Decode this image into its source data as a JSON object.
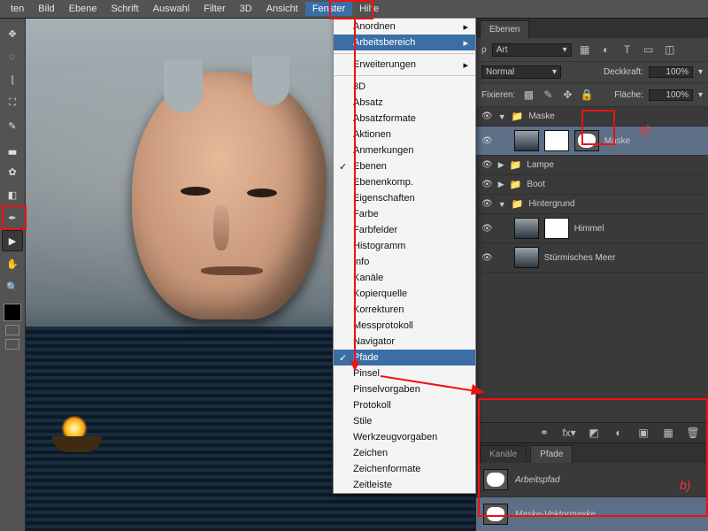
{
  "menubar": [
    "ten",
    "Bild",
    "Ebene",
    "Schrift",
    "Auswahl",
    "Filter",
    "3D",
    "Ansicht",
    "Fenster",
    "Hilfe"
  ],
  "menubar_open": 8,
  "dropdown": {
    "sections": [
      [
        {
          "label": "Anordnen",
          "sub": true
        },
        {
          "label": "Arbeitsbereich",
          "sub": true,
          "hl": true
        }
      ],
      [
        {
          "label": "Erweiterungen",
          "sub": true
        }
      ],
      [
        {
          "label": "3D"
        },
        {
          "label": "Absatz"
        },
        {
          "label": "Absatzformate"
        },
        {
          "label": "Aktionen"
        },
        {
          "label": "Anmerkungen"
        },
        {
          "label": "Ebenen",
          "chk": true
        },
        {
          "label": "Ebenenkomp."
        },
        {
          "label": "Eigenschaften"
        },
        {
          "label": "Farbe"
        },
        {
          "label": "Farbfelder"
        },
        {
          "label": "Histogramm"
        },
        {
          "label": "Info"
        },
        {
          "label": "Kanäle"
        },
        {
          "label": "Kopierquelle"
        },
        {
          "label": "Korrekturen"
        },
        {
          "label": "Messprotokoll"
        },
        {
          "label": "Navigator"
        },
        {
          "label": "Pfade",
          "chk": true,
          "hl": true
        },
        {
          "label": "Pinsel"
        },
        {
          "label": "Pinselvorgaben"
        },
        {
          "label": "Protokoll"
        },
        {
          "label": "Stile"
        },
        {
          "label": "Werkzeugvorgaben"
        },
        {
          "label": "Zeichen"
        },
        {
          "label": "Zeichenformate"
        },
        {
          "label": "Zeitleiste"
        }
      ]
    ]
  },
  "right": {
    "panel_tab": "Ebenen",
    "filter_label": "Art",
    "blend": "Normal",
    "opacity_label": "Deckkraft:",
    "opacity": "100%",
    "lock_label": "Fixieren:",
    "fill_label": "Fläche:",
    "fill": "100%",
    "layers": [
      {
        "type": "group",
        "name": "Maske",
        "open": true
      },
      {
        "type": "layer",
        "name": "Maske",
        "sel": true,
        "indent": 1,
        "thumbs": [
          "img",
          "white",
          "vpath"
        ]
      },
      {
        "type": "group",
        "name": "Lampe",
        "indent": 0
      },
      {
        "type": "group",
        "name": "Boot",
        "indent": 0
      },
      {
        "type": "group",
        "name": "Hintergrund",
        "open": true,
        "indent": 0
      },
      {
        "type": "layer",
        "name": "Himmel",
        "indent": 1,
        "thumbs": [
          "img",
          "white"
        ]
      },
      {
        "type": "layer",
        "name": "Stürmisches Meer",
        "indent": 1,
        "thumbs": [
          "img"
        ]
      }
    ],
    "paths_tab_inactive": "Kanäle",
    "paths_tab": "Pfade",
    "paths": [
      {
        "name": "Arbeitspfad",
        "italic": true
      },
      {
        "name": "Maske-Vektormaske",
        "italic": true,
        "sel": true
      }
    ]
  },
  "annotations": {
    "a": "a)",
    "b": "b)"
  }
}
